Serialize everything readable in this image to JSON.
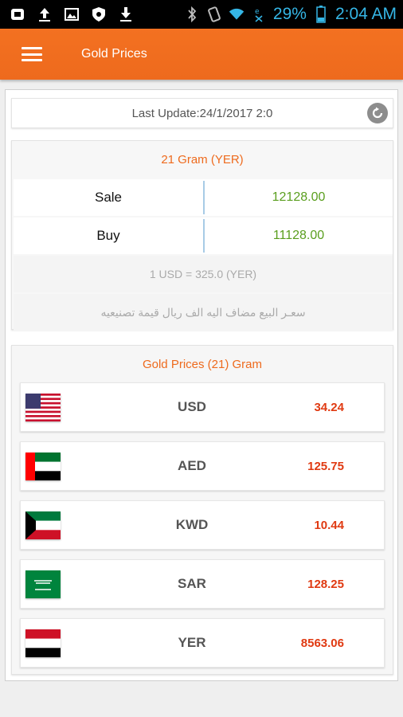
{
  "status_bar": {
    "icons": [
      "notification-icon",
      "upload-icon",
      "image-icon",
      "shield-icon",
      "download-icon",
      "bluetooth-icon",
      "vibrate-icon",
      "wifi-icon",
      "no-sim-icon",
      "battery-icon"
    ],
    "battery": "29%",
    "time": "2:04 AM",
    "accent": "#35b6e6"
  },
  "app_bar": {
    "title": "Gold Prices",
    "menu_icon": "hamburger-menu-icon",
    "color": "#ee6a1d"
  },
  "update": {
    "text": "Last Update:24/1/2017 2:0",
    "refresh_icon": "refresh-icon"
  },
  "price_card": {
    "title": "21 Gram (YER)",
    "rows": [
      {
        "label": "Sale",
        "value": "12128.00"
      },
      {
        "label": "Buy",
        "value": "11128.00"
      }
    ],
    "rate": "1 USD = 325.0  (YER)",
    "note": "سعـر البيع مضاف اليه الف ريال قيمة تصنيعيه",
    "value_color": "#5a9e1e"
  },
  "currency_list": {
    "title": "Gold Prices (21) Gram",
    "rows": [
      {
        "code": "USD",
        "value": "34.24",
        "flag": "usa-flag"
      },
      {
        "code": "AED",
        "value": "125.75",
        "flag": "uae-flag"
      },
      {
        "code": "KWD",
        "value": "10.44",
        "flag": "kuwait-flag"
      },
      {
        "code": "SAR",
        "value": "128.25",
        "flag": "saudi-flag"
      },
      {
        "code": "YER",
        "value": "8563.06",
        "flag": "yemen-flag"
      }
    ],
    "value_color": "#e03a12"
  }
}
